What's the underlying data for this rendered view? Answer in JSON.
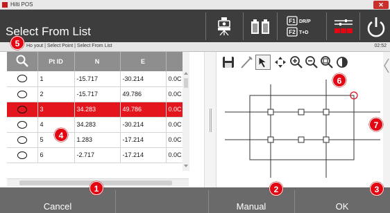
{
  "window": {
    "title": "Hilti POS",
    "close_glyph": "✕"
  },
  "header": {
    "title": "Select From List",
    "icons": [
      "instrument-icon",
      "battery-icon",
      "function-keys-icon",
      "settings-icon",
      "power-icon"
    ],
    "function_keys": {
      "f1": "F1",
      "f1_label": "DR/P",
      "f2": "F2",
      "f2_label": "T+D"
    }
  },
  "breadcrumb": {
    "text": "Ho   yout | Select Point | Select From List",
    "time": "02:52"
  },
  "table": {
    "columns": [
      "",
      "Pt ID",
      "N",
      "E",
      ""
    ],
    "rows": [
      {
        "id": "1",
        "n": "-15.717",
        "e": "-30.214",
        "h": "0.0C",
        "selected": false
      },
      {
        "id": "2",
        "n": "-15.717",
        "e": "49.786",
        "h": "0.0C",
        "selected": false
      },
      {
        "id": "3",
        "n": "34.283",
        "e": "49.786",
        "h": "0.0C",
        "selected": true
      },
      {
        "id": "4",
        "n": "34.283",
        "e": "-30.214",
        "h": "0.0C",
        "selected": false
      },
      {
        "id": "5",
        "n": "1.283",
        "e": "-17.214",
        "h": "0.0C",
        "selected": false
      },
      {
        "id": "6",
        "n": "-2.717",
        "e": "-17.214",
        "h": "0.0C",
        "selected": false
      }
    ]
  },
  "graphic_toolbar": [
    "save-icon",
    "measure-icon",
    "select-arrow-icon",
    "pan-icon",
    "zoom-in-icon",
    "zoom-out-icon",
    "zoom-fit-icon",
    "contrast-icon"
  ],
  "footer": {
    "cancel": "Cancel",
    "manual": "Manual",
    "ok": "OK"
  },
  "badges": [
    "1",
    "2",
    "3",
    "4",
    "5",
    "6",
    "7"
  ],
  "colors": {
    "accent": "#e30613",
    "selected_row": "#e4161d",
    "header_bg": "#3d3d3d",
    "footer_bg": "#6a6a6a"
  }
}
